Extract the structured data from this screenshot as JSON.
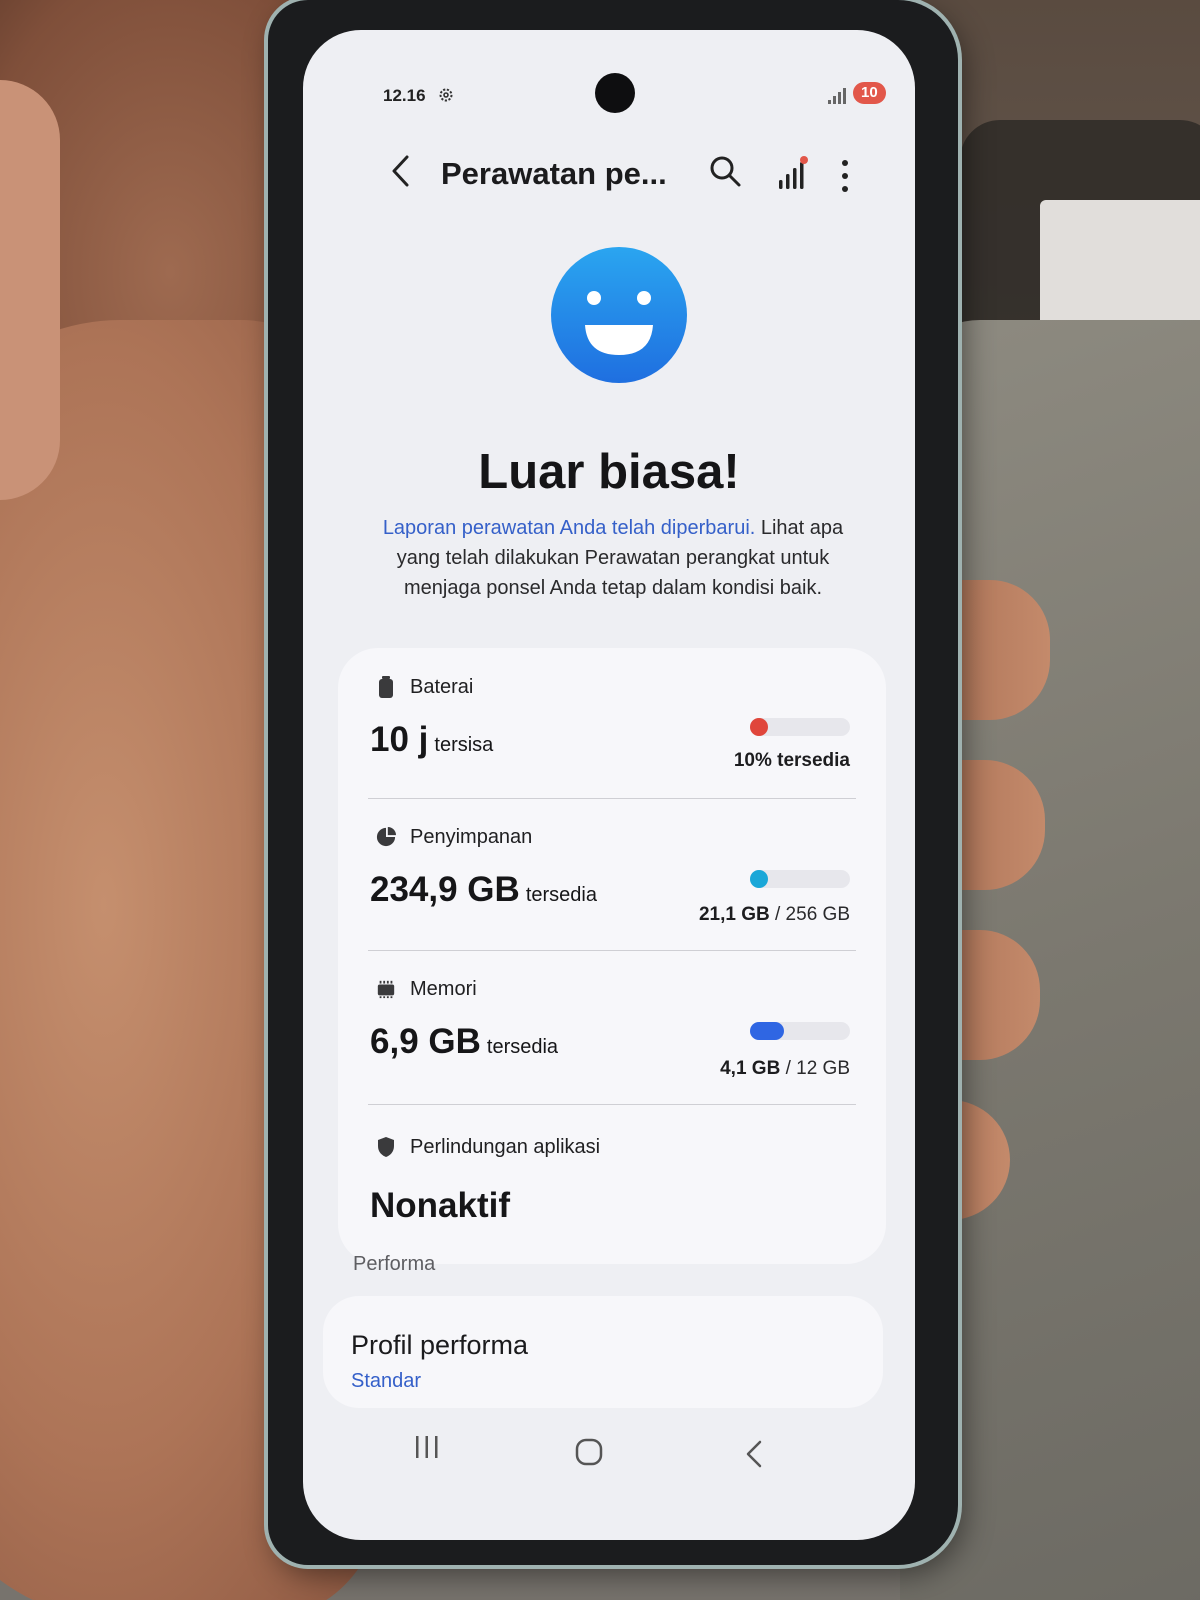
{
  "status_bar": {
    "time": "12.16",
    "battery_level": "10"
  },
  "app_bar": {
    "title": "Perawatan pe..."
  },
  "hero": {
    "headline": "Luar biasa!",
    "link_text": "Laporan perawatan Anda telah diperbarui.",
    "description": " Lihat apa yang telah dilakukan Perawatan perangkat untuk menjaga ponsel Anda tetap dalam kondisi baik."
  },
  "battery": {
    "label": "Baterai",
    "value": "10 j",
    "unit": "tersisa",
    "usage": "10% tersedia",
    "fraction": 0.1,
    "color": "#e0463b"
  },
  "storage": {
    "label": "Penyimpanan",
    "value": "234,9 GB",
    "unit": "tersedia",
    "used": "21,1 GB",
    "total": "/ 256 GB",
    "fraction": 0.08,
    "color": "#1aa7d8"
  },
  "memory": {
    "label": "Memori",
    "value": "6,9 GB",
    "unit": "tersedia",
    "used": "4,1 GB",
    "total": "/ 12 GB",
    "fraction": 0.34,
    "color": "#2f66e3"
  },
  "app_protection": {
    "label": "Perlindungan aplikasi",
    "value": "Nonaktif"
  },
  "performance": {
    "section_title": "Performa",
    "item_title": "Profil performa",
    "item_value": "Standar"
  },
  "icons": {
    "back": "back-icon",
    "search": "search-icon",
    "stats": "stats-icon",
    "more": "more-icon",
    "smiley": "smiley-icon",
    "battery": "battery-icon",
    "storage": "storage-icon",
    "memory": "memory-icon",
    "shield": "shield-icon"
  }
}
